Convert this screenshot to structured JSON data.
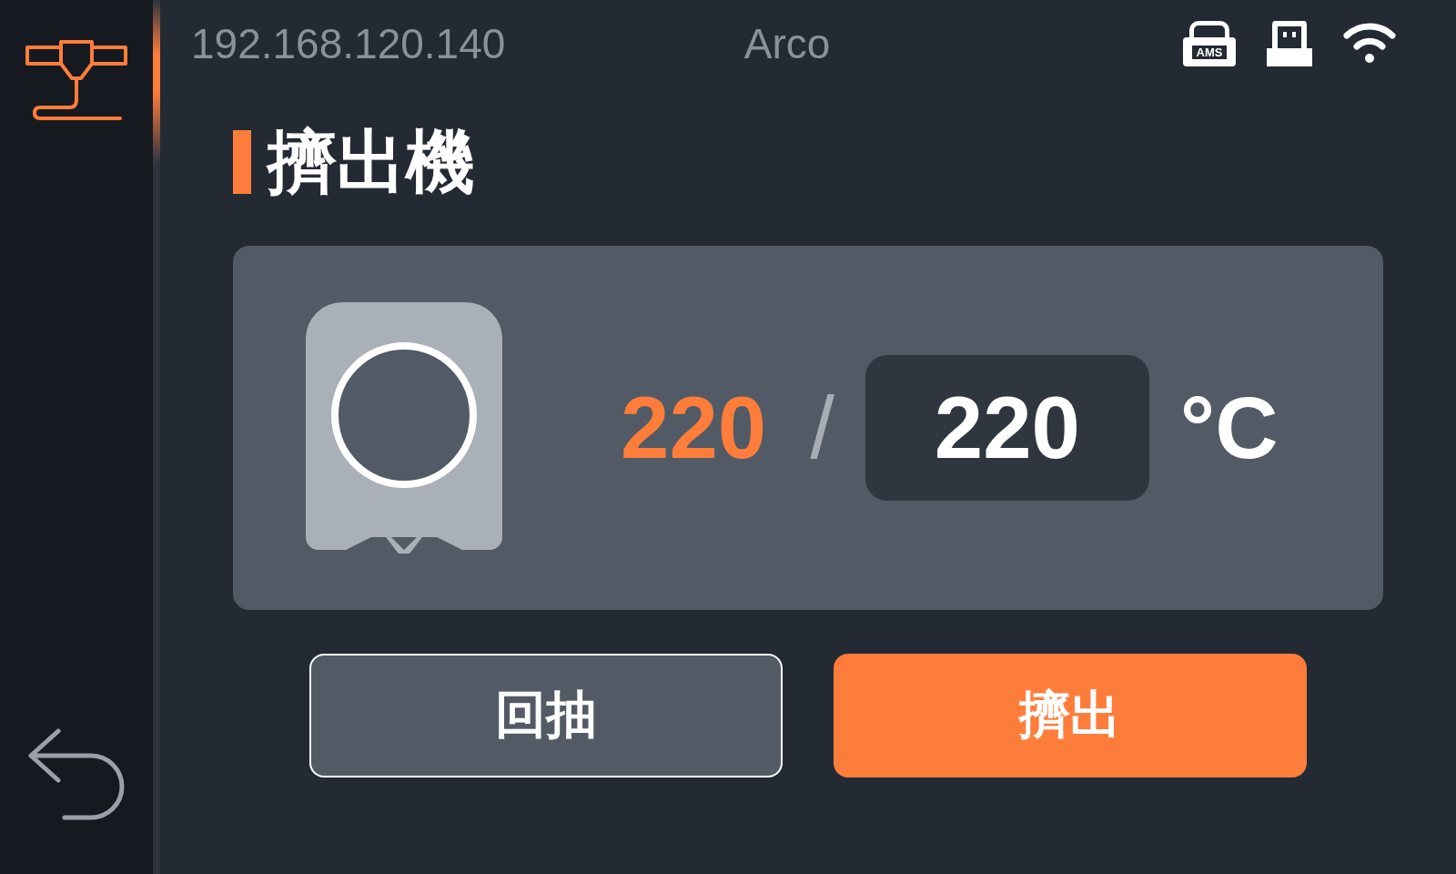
{
  "sidebar": {
    "items": [
      {
        "kind": "extruder",
        "selected": true
      }
    ],
    "back": {
      "kind": "back"
    }
  },
  "header": {
    "address": "192.168.120.140",
    "printer_name": "Arco",
    "status_icons": [
      {
        "kind": "ams",
        "label": "AMS"
      },
      {
        "kind": "usb"
      },
      {
        "kind": "wifi"
      }
    ]
  },
  "title": "擠出機",
  "temperature": {
    "current": "220",
    "separator": "/",
    "target": "220",
    "unit": "°C"
  },
  "buttons": [
    {
      "label": "回抽",
      "kind": "secondary"
    },
    {
      "label": "擠出",
      "kind": "primary"
    }
  ]
}
